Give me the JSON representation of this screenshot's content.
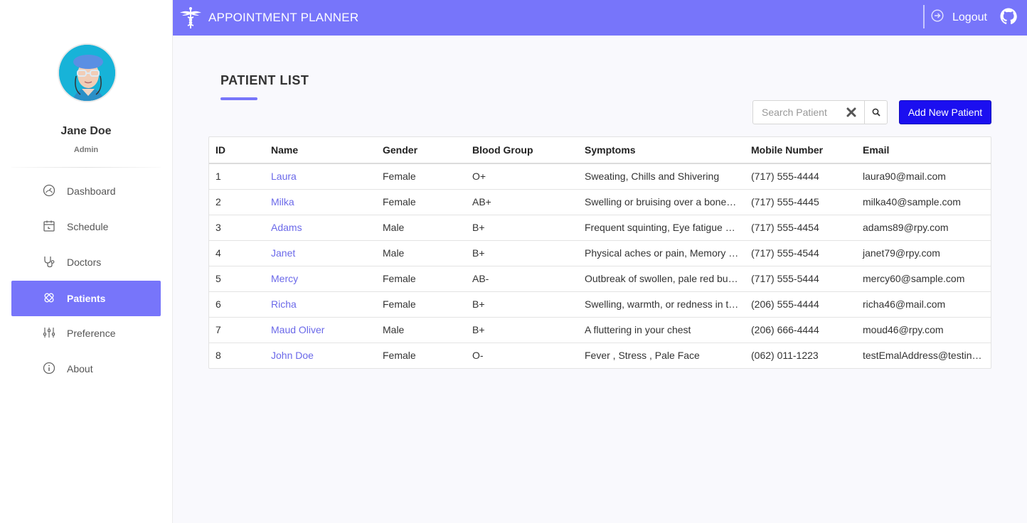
{
  "app": {
    "title": "APPOINTMENT PLANNER",
    "logout_label": "Logout"
  },
  "user": {
    "name": "Jane Doe",
    "role": "Admin"
  },
  "sidebar": {
    "items": [
      {
        "label": "Dashboard",
        "icon": "dashboard-icon"
      },
      {
        "label": "Schedule",
        "icon": "calendar-icon"
      },
      {
        "label": "Doctors",
        "icon": "stethoscope-icon"
      },
      {
        "label": "Patients",
        "icon": "patients-icon",
        "active": true
      },
      {
        "label": "Preference",
        "icon": "sliders-icon"
      },
      {
        "label": "About",
        "icon": "info-icon"
      }
    ]
  },
  "main": {
    "page_title": "PATIENT LIST",
    "search_placeholder": "Search Patient",
    "add_button_label": "Add New Patient"
  },
  "table": {
    "columns": [
      "ID",
      "Name",
      "Gender",
      "Blood Group",
      "Symptoms",
      "Mobile Number",
      "Email"
    ],
    "rows": [
      [
        "1",
        "Laura",
        "Female",
        "O+",
        "Sweating, Chills and Shivering",
        "(717) 555-4444",
        "laura90@mail.com"
      ],
      [
        "2",
        "Milka",
        "Female",
        "AB+",
        "Swelling or bruising over a bone,…",
        "(717) 555-4445",
        "milka40@sample.com"
      ],
      [
        "3",
        "Adams",
        "Male",
        "B+",
        "Frequent squinting, Eye fatigue o…",
        "(717) 555-4454",
        "adams89@rpy.com"
      ],
      [
        "4",
        "Janet",
        "Male",
        "B+",
        "Physical aches or pain, Memory …",
        "(717) 555-4544",
        "janet79@rpy.com"
      ],
      [
        "5",
        "Mercy",
        "Female",
        "AB-",
        "Outbreak of swollen, pale red bu…",
        "(717) 555-5444",
        "mercy60@sample.com"
      ],
      [
        "6",
        "Richa",
        "Female",
        "B+",
        "Swelling, warmth, or redness in t…",
        "(206) 555-4444",
        "richa46@mail.com"
      ],
      [
        "7",
        "Maud Oliver",
        "Male",
        "B+",
        "A fluttering in your chest",
        "(206) 666-4444",
        "moud46@rpy.com"
      ],
      [
        "8",
        "John Doe",
        "Female",
        "O-",
        "Fever , Stress , Pale Face",
        "(062) 011-1223",
        "testEmalAddress@testin…"
      ]
    ]
  },
  "colors": {
    "accent": "#7775fa",
    "primary_button": "#1b0ff0",
    "link": "#6b69e9"
  }
}
